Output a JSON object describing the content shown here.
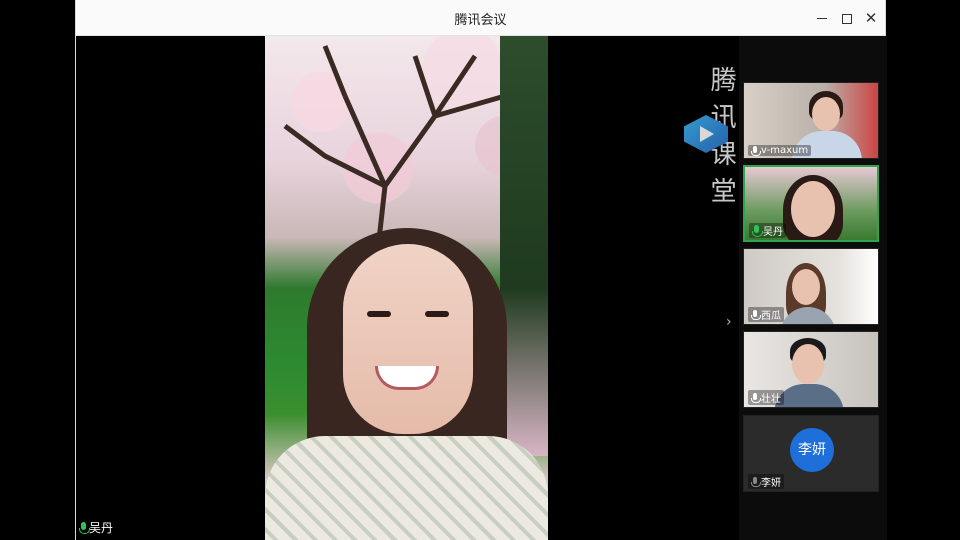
{
  "window": {
    "title": "腾讯会议"
  },
  "watermark": {
    "text": "腾讯课堂"
  },
  "main": {
    "speaker_label": "吴丹"
  },
  "participants": [
    {
      "name": "v-maxum",
      "muted": false,
      "active": false
    },
    {
      "name": "吴丹",
      "muted": false,
      "active": true
    },
    {
      "name": "西瓜",
      "muted": false,
      "active": false
    },
    {
      "name": "壮壮",
      "muted": false,
      "active": false
    },
    {
      "name": "李妍",
      "muted": true,
      "active": false,
      "avatar_text": "李妍",
      "avatar_color": "#1e6fd9"
    }
  ],
  "icons": {
    "minimize": "minimize-icon",
    "maximize": "maximize-icon",
    "close": "close-icon",
    "expand": "chevron-right-icon"
  }
}
